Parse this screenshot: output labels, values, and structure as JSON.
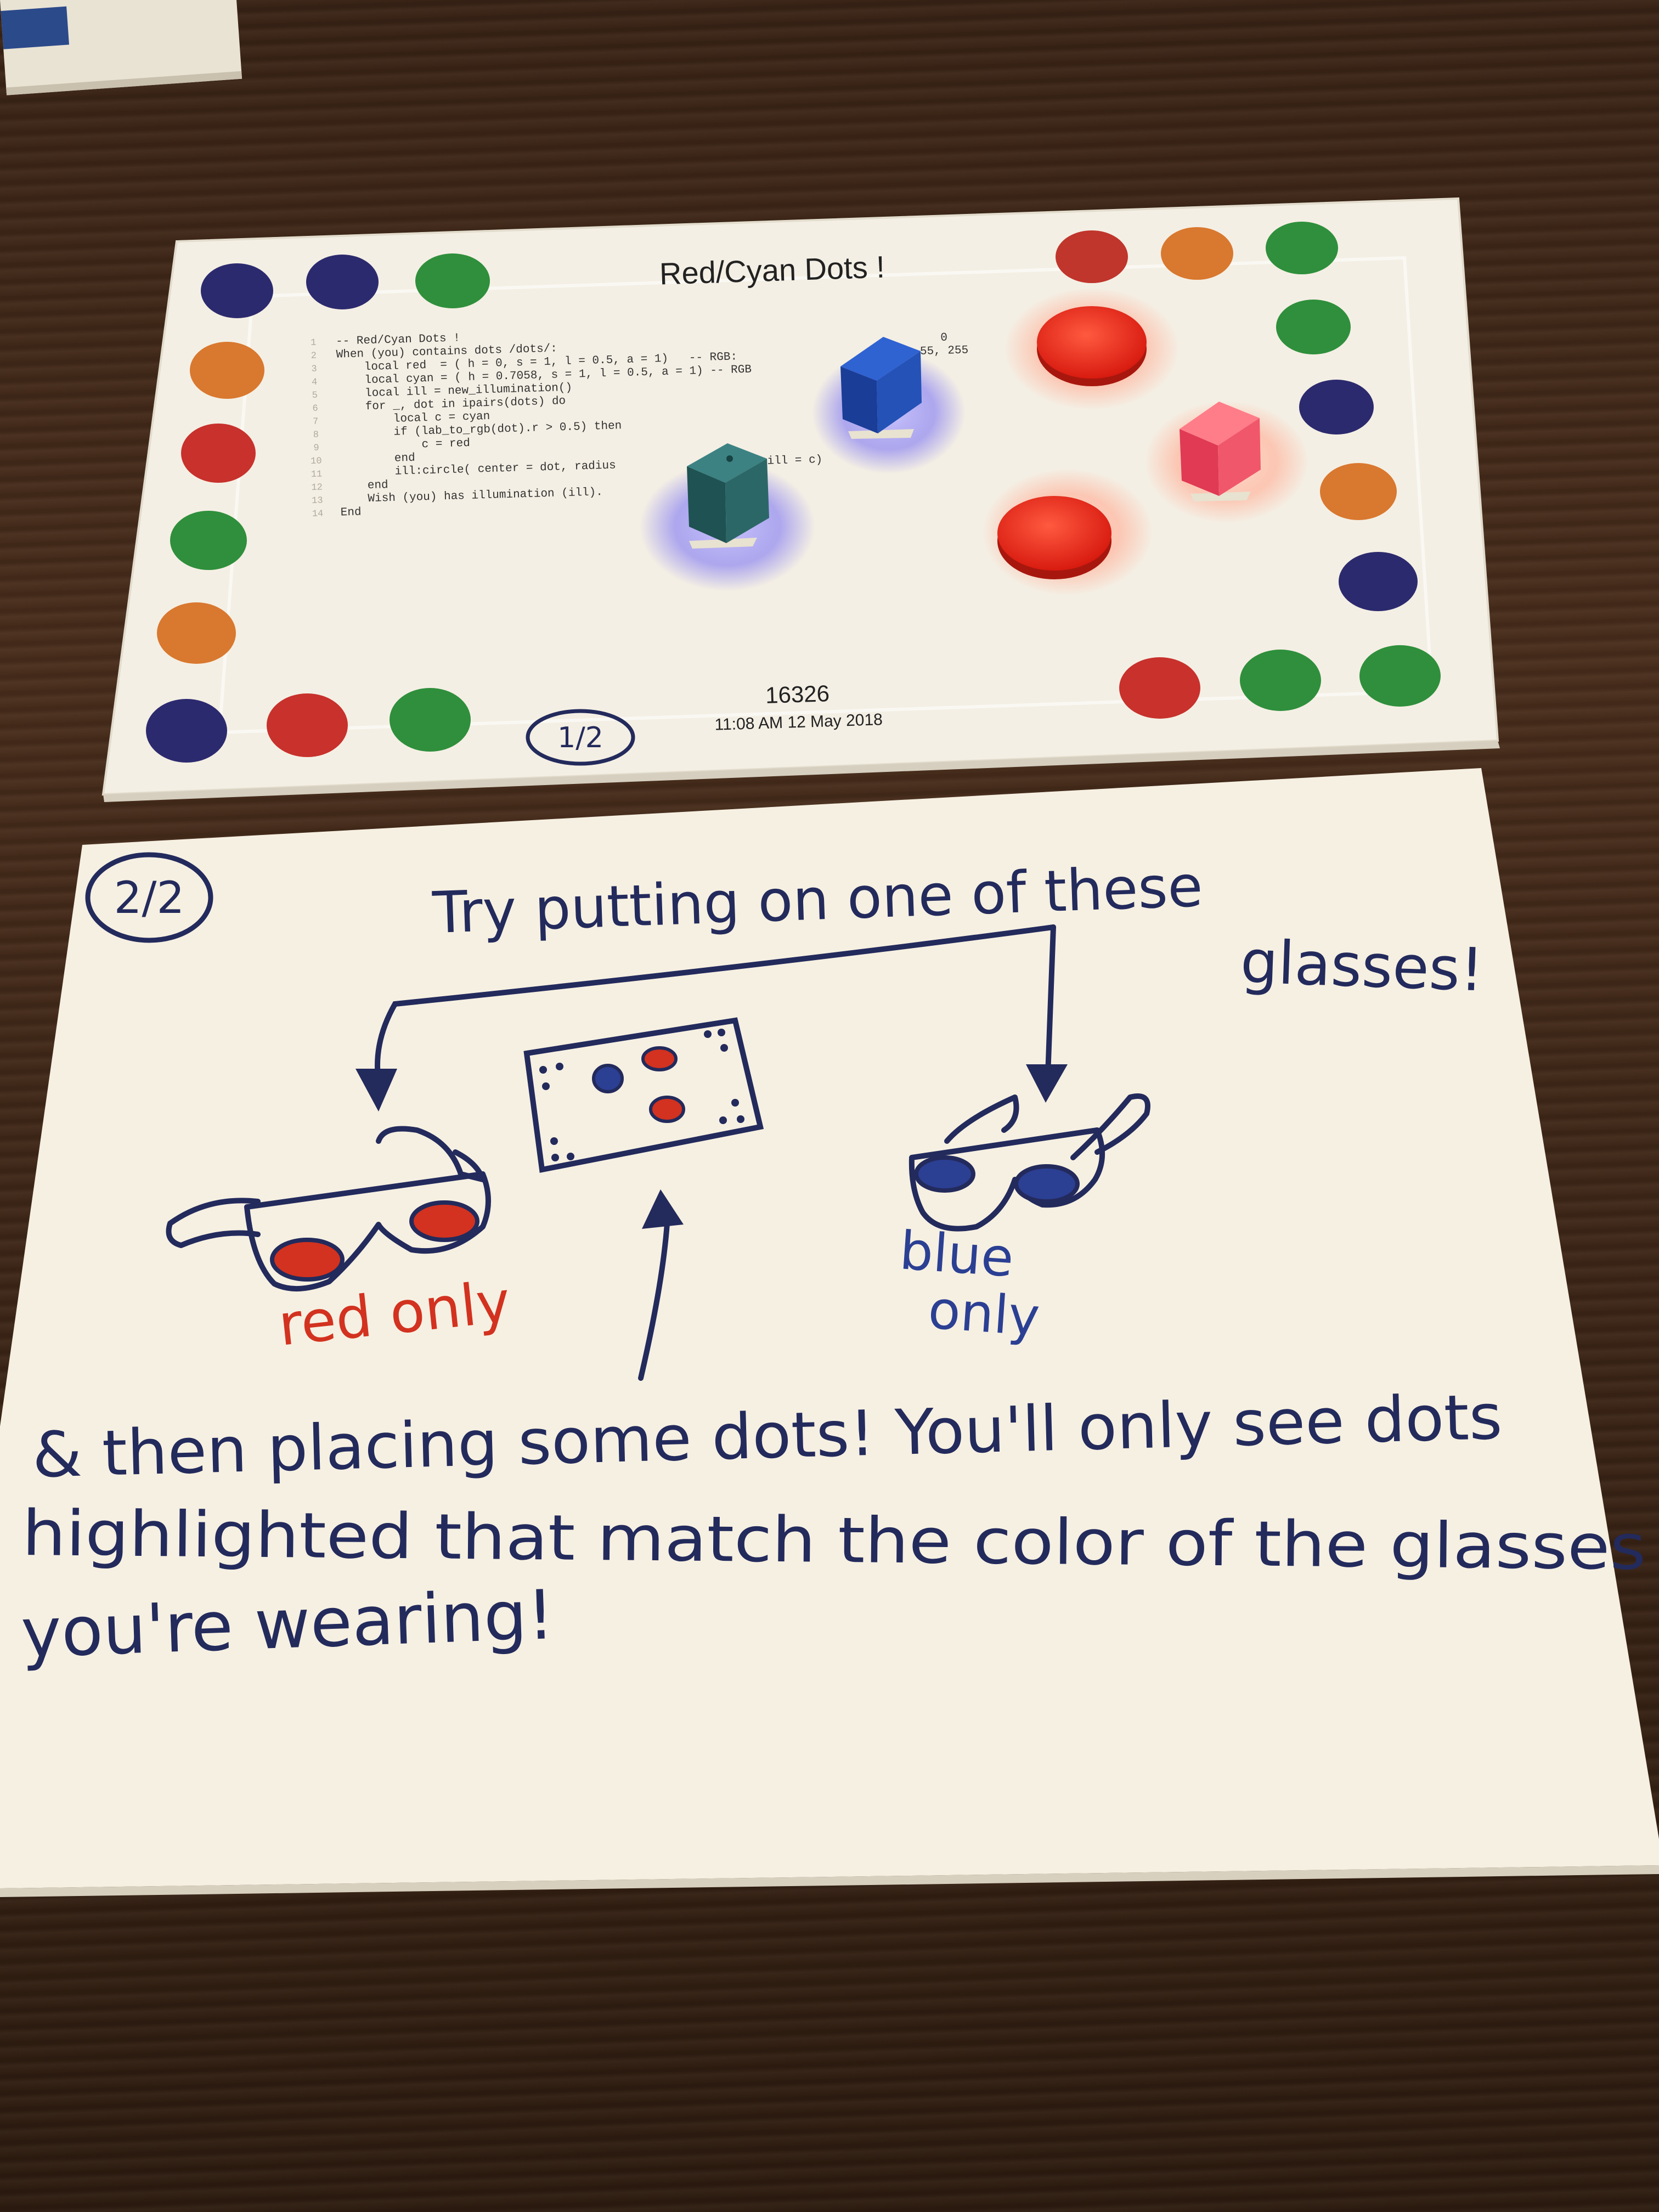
{
  "card1": {
    "title": "Red/Cyan Dots !",
    "code_lines": [
      "-- Red/Cyan Dots !",
      "When (you) contains dots /dots/:",
      "    local red  = ( h = 0, s = 1, l = 0.5, a = 1)   -- RGB:",
      "    local cyan = ( h = 0.7058, s = 1, l = 0.5, a = 1) -- RGB",
      "    local ill = new_illumination()",
      "    for _, dot in ipairs(dots) do",
      "        local c = cyan",
      "        if (lab_to_rgb(dot).r > 0.5) then",
      "            c = red",
      "        end",
      "        ill:circle( center = dot, radius",
      "    end",
      "    Wish (you) has illumination (ill).",
      "End"
    ],
    "line_numbers": [
      "1",
      "2",
      "3",
      "4",
      "5",
      "6",
      "7",
      "8",
      "9",
      "10",
      "11",
      "12",
      "13",
      "14"
    ],
    "code_fragments": {
      "rgb_tail": "0",
      "rgb_tail_2": "55, 255",
      "ill_tail": "ill = c)"
    },
    "program_id": "16326",
    "timestamp": "11:08 AM 12 May 2018",
    "page_label": "1/2",
    "colors": {
      "paper": "#f4efe4",
      "dot_purple": "#2c2a6e",
      "dot_green": "#2f8f3c",
      "dot_red": "#c8312c",
      "dot_orange": "#d9782f",
      "cube_blue": "#1f4fb8",
      "cube_teal": "#2d6a6a",
      "cube_pink": "#f0576a",
      "disc_red": "#e8261d",
      "glow_blue": "#8f88f2",
      "glow_red": "#ffb59e"
    }
  },
  "card2": {
    "page_label": "2/2",
    "heading_1": "Try putting on one of these",
    "heading_2": "glasses!",
    "label_red": "red only",
    "label_blue_1": "blue",
    "label_blue_2": "only",
    "body_lines": [
      "& then placing some dots! You'll only see dots",
      "highlighted that match  the color of the glasses",
      "you're wearing!"
    ],
    "colors": {
      "paper": "#f6f0e2",
      "ink": "#232a5c",
      "ink_red": "#d2321f",
      "ink_blue": "#2b3f93"
    }
  }
}
